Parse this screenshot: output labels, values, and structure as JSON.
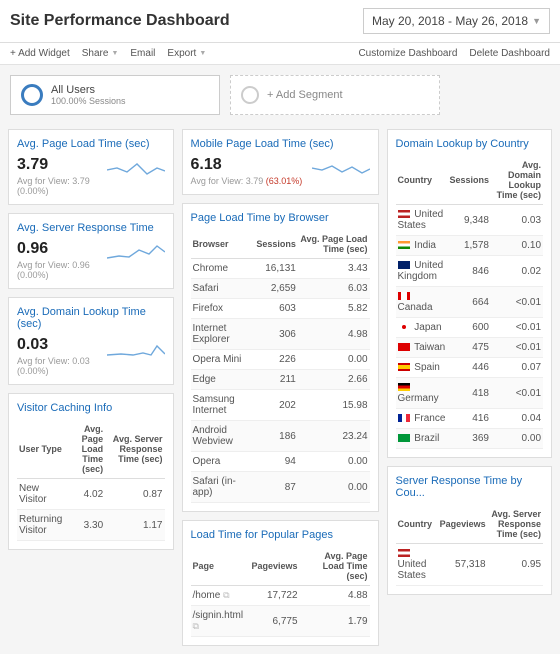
{
  "header": {
    "title": "Site Performance Dashboard",
    "date_range": "May 20, 2018 - May 26, 2018"
  },
  "toolbar": {
    "add_widget": "+ Add Widget",
    "share": "Share",
    "email": "Email",
    "export": "Export",
    "customize": "Customize Dashboard",
    "delete": "Delete Dashboard"
  },
  "segments": {
    "all_users": "All Users",
    "all_users_sub": "100.00% Sessions",
    "add_segment": "+ Add Segment"
  },
  "kpi": {
    "avg_load": {
      "title": "Avg. Page Load Time (sec)",
      "value": "3.79",
      "sub": "Avg for View: 3.79 (0.00%)"
    },
    "avg_resp": {
      "title": "Avg. Server Response Time",
      "value": "0.96",
      "sub": "Avg for View: 0.96 (0.00%)"
    },
    "avg_dom": {
      "title": "Avg. Domain Lookup Time (sec)",
      "value": "0.03",
      "sub": "Avg for View: 0.03 (0.00%)"
    },
    "mobile": {
      "title": "Mobile Page Load Time (sec)",
      "value": "6.18",
      "sub_pre": "Avg for View: 3.79 ",
      "sub_pct": "(63.01%)"
    }
  },
  "visitor": {
    "title": "Visitor Caching Info",
    "cols": [
      "User Type",
      "Avg. Page Load Time (sec)",
      "Avg. Server Response Time (sec)"
    ],
    "rows": [
      [
        "New Visitor",
        "4.02",
        "0.87"
      ],
      [
        "Returning Visitor",
        "3.30",
        "1.17"
      ]
    ]
  },
  "browser": {
    "title": "Page Load Time by Browser",
    "cols": [
      "Browser",
      "Sessions",
      "Avg. Page Load Time (sec)"
    ],
    "rows": [
      [
        "Chrome",
        "16,131",
        "3.43"
      ],
      [
        "Safari",
        "2,659",
        "6.03"
      ],
      [
        "Firefox",
        "603",
        "5.82"
      ],
      [
        "Internet Explorer",
        "306",
        "4.98"
      ],
      [
        "Opera Mini",
        "226",
        "0.00"
      ],
      [
        "Edge",
        "211",
        "2.66"
      ],
      [
        "Samsung Internet",
        "202",
        "15.98"
      ],
      [
        "Android Webview",
        "186",
        "23.24"
      ],
      [
        "Opera",
        "94",
        "0.00"
      ],
      [
        "Safari (in-app)",
        "87",
        "0.00"
      ]
    ]
  },
  "country": {
    "title": "Domain Lookup by Country",
    "cols": [
      "Country",
      "Sessions",
      "Avg. Domain Lookup Time (sec)"
    ],
    "rows": [
      {
        "flag": "us",
        "c": "United States",
        "s": "9,348",
        "v": "0.03"
      },
      {
        "flag": "in",
        "c": "India",
        "s": "1,578",
        "v": "0.10"
      },
      {
        "flag": "gb",
        "c": "United Kingdom",
        "s": "846",
        "v": "0.02"
      },
      {
        "flag": "ca",
        "c": "Canada",
        "s": "664",
        "v": "<0.01"
      },
      {
        "flag": "jp",
        "c": "Japan",
        "s": "600",
        "v": "<0.01"
      },
      {
        "flag": "tw",
        "c": "Taiwan",
        "s": "475",
        "v": "<0.01"
      },
      {
        "flag": "es",
        "c": "Spain",
        "s": "446",
        "v": "0.07"
      },
      {
        "flag": "de",
        "c": "Germany",
        "s": "418",
        "v": "<0.01"
      },
      {
        "flag": "fr",
        "c": "France",
        "s": "416",
        "v": "0.04"
      },
      {
        "flag": "br",
        "c": "Brazil",
        "s": "369",
        "v": "0.00"
      }
    ]
  },
  "pages": {
    "title": "Load Time for Popular Pages",
    "cols": [
      "Page",
      "Pageviews",
      "Avg. Page Load Time (sec)"
    ],
    "rows": [
      [
        "/home",
        "17,722",
        "4.88"
      ],
      [
        "/signin.html",
        "6,775",
        "1.79"
      ]
    ]
  },
  "srv": {
    "title": "Server Response Time by Cou...",
    "cols": [
      "Country",
      "Pageviews",
      "Avg. Server Response Time (sec)"
    ],
    "rows": [
      {
        "flag": "us",
        "c": "United States",
        "p": "57,318",
        "v": "0.95"
      }
    ]
  }
}
